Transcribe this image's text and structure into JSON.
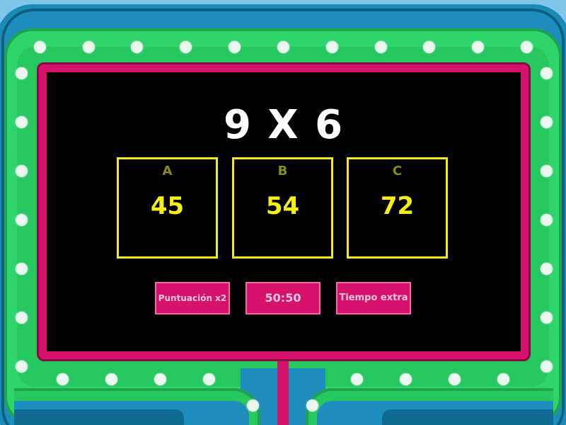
{
  "game": {
    "question": "9 X 6",
    "answers": [
      {
        "letter": "A",
        "value": "45"
      },
      {
        "letter": "B",
        "value": "54"
      },
      {
        "letter": "C",
        "value": "72"
      }
    ],
    "powerups": [
      {
        "label": "Puntuación x2"
      },
      {
        "label": "50:50"
      },
      {
        "label": "Tiempo extra"
      }
    ]
  },
  "colors": {
    "board": "#000000",
    "frame": "#d6126d",
    "marquee": "#27c760",
    "answer_border": "#f5ea1a",
    "answer_value": "#f7ee12",
    "question_text": "#ffffff"
  }
}
